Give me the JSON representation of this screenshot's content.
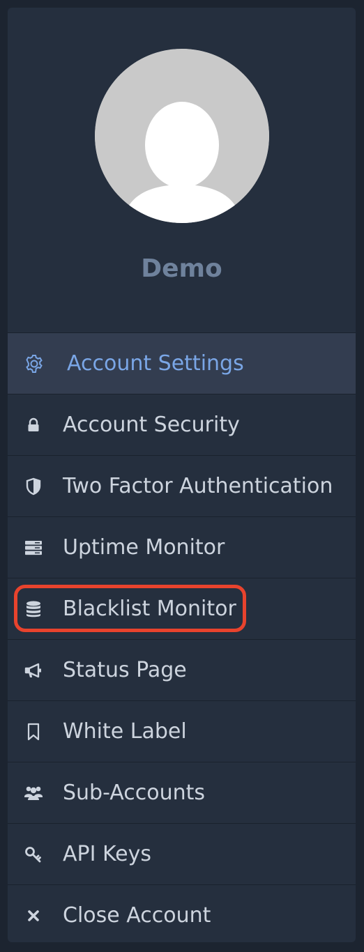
{
  "profile": {
    "username": "Demo"
  },
  "menu": {
    "items": [
      {
        "label": "Account Settings",
        "icon": "gear-icon",
        "active": true
      },
      {
        "label": "Account Security",
        "icon": "lock-icon"
      },
      {
        "label": "Two Factor Authentication",
        "icon": "shield-icon"
      },
      {
        "label": "Uptime Monitor",
        "icon": "server-icon"
      },
      {
        "label": "Blacklist Monitor",
        "icon": "database-icon",
        "highlighted": true
      },
      {
        "label": "Status Page",
        "icon": "megaphone-icon"
      },
      {
        "label": "White Label",
        "icon": "bookmark-icon"
      },
      {
        "label": "Sub-Accounts",
        "icon": "users-icon"
      },
      {
        "label": "API Keys",
        "icon": "key-icon"
      },
      {
        "label": "Close Account",
        "icon": "close-icon"
      }
    ]
  },
  "colors": {
    "background": "#1c2430",
    "panel": "#252f3e",
    "active_item": "#333d50",
    "active_text": "#7aa6e6",
    "text": "#cdd4de",
    "username": "#6f829c",
    "highlight": "#e8432d"
  }
}
